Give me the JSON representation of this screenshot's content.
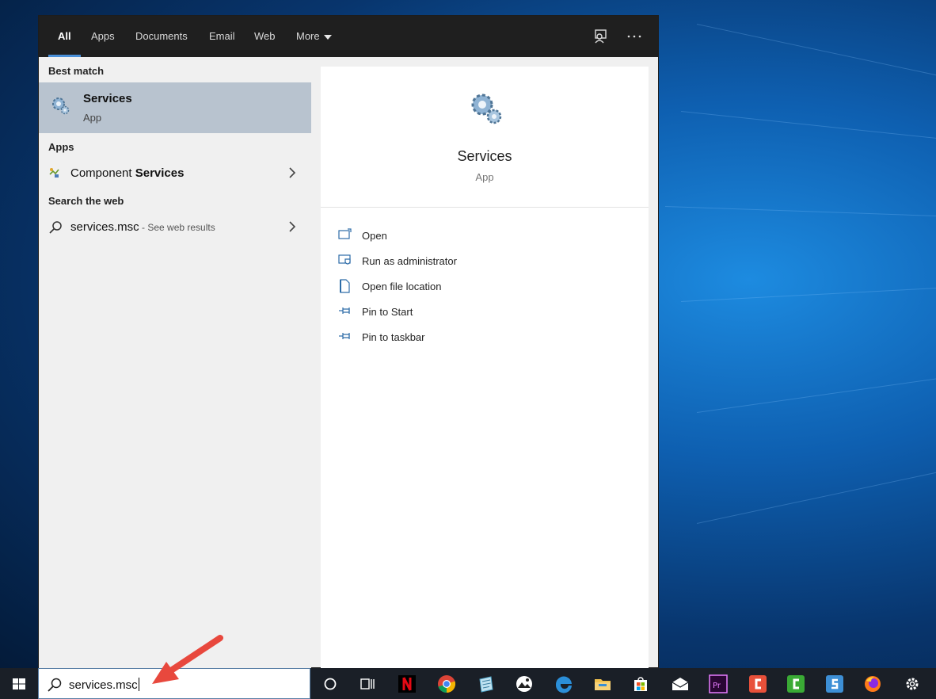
{
  "tabs": [
    {
      "label": "All",
      "active": true
    },
    {
      "label": "Apps",
      "active": false
    },
    {
      "label": "Documents",
      "active": false
    },
    {
      "label": "Email",
      "active": false
    },
    {
      "label": "Web",
      "active": false
    },
    {
      "label": "More",
      "active": false
    }
  ],
  "left": {
    "best_match_heading": "Best match",
    "best_match": {
      "title": "Services",
      "subtitle": "App"
    },
    "apps_heading": "Apps",
    "apps": [
      {
        "prefix": "Component ",
        "bold": "Services"
      }
    ],
    "web_heading": "Search the web",
    "web": [
      {
        "query": "services.msc",
        "hint": " - See web results"
      }
    ]
  },
  "preview": {
    "title": "Services",
    "subtitle": "App",
    "actions": [
      {
        "label": "Open",
        "icon": "open-window-icon"
      },
      {
        "label": "Run as administrator",
        "icon": "shield-window-icon"
      },
      {
        "label": "Open file location",
        "icon": "file-location-icon"
      },
      {
        "label": "Pin to Start",
        "icon": "pin-icon"
      },
      {
        "label": "Pin to taskbar",
        "icon": "pin-icon"
      }
    ]
  },
  "taskbar": {
    "search_value": "services.msc",
    "apps": [
      "windows-start-icon",
      "cortana-icon",
      "task-view-icon",
      "netflix-icon",
      "chrome-icon",
      "notepad-icon",
      "photos-icon",
      "edge-icon",
      "file-explorer-icon",
      "store-icon",
      "mail-icon",
      "premiere-icon",
      "camtasia-icon",
      "camtasia-green-icon",
      "snagit-icon",
      "firefox-icon",
      "settings-gear-icon"
    ]
  },
  "colors": {
    "accent": "#4a90d9",
    "selected": "#b8c3cf",
    "topbar": "#1f1f1f",
    "arrow": "#e8483d"
  }
}
